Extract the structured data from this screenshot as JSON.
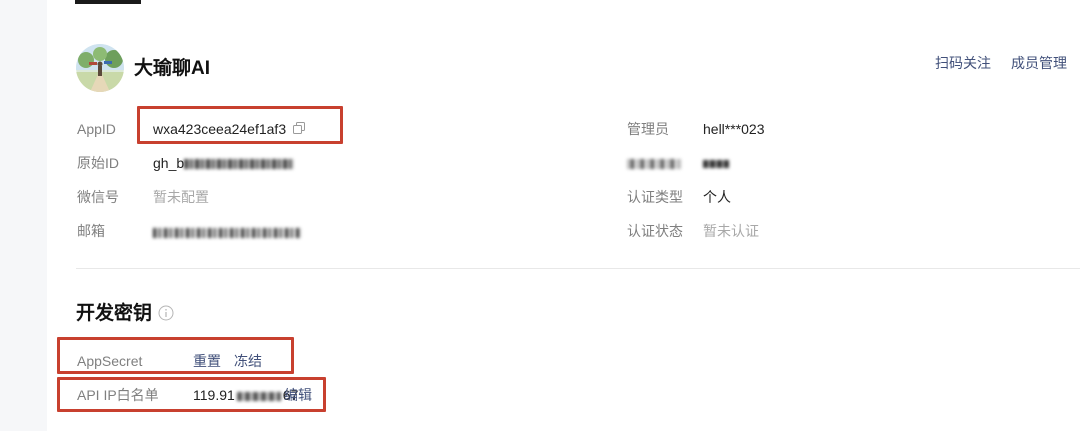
{
  "account": {
    "name": "大瑜聊AI",
    "header_links": {
      "scan_follow": "扫码关注",
      "member_manage": "成员管理"
    }
  },
  "info": {
    "appid_label": "AppID",
    "appid_value": "wxa423ceea24ef1af3",
    "origin_id_label": "原始ID",
    "origin_id_value": "gh_b",
    "wechat_label": "微信号",
    "wechat_value": "暂未配置",
    "email_label": "邮箱",
    "admin_label": "管理员",
    "admin_value": "hell***023",
    "cert_type_label": "认证类型",
    "cert_type_value": "个人",
    "cert_status_label": "认证状态",
    "cert_status_value": "暂未认证"
  },
  "dev_keys": {
    "title": "开发密钥",
    "appsecret_label": "AppSecret",
    "reset_label": "重置",
    "freeze_label": "冻结",
    "ip_whitelist_label": "API IP白名单",
    "ip_value_prefix": "119.91",
    "ip_value_suffix": "67",
    "edit_label": "编辑"
  },
  "colors": {
    "link": "#41507a",
    "highlight_box": "#c8402f",
    "sidebar_bg": "#f6f7f9"
  },
  "icons": [
    "copy-icon",
    "info-icon"
  ]
}
